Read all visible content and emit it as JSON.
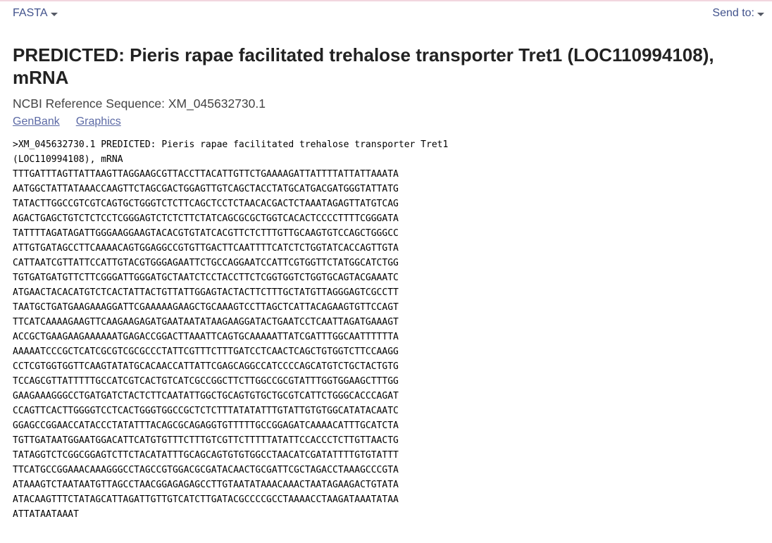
{
  "toolbar": {
    "format_label": "FASTA",
    "send_to_label": "Send to:"
  },
  "record": {
    "title": "PREDICTED: Pieris rapae facilitated trehalose transporter Tret1 (LOC110994108), mRNA",
    "reference": "NCBI Reference Sequence: XM_045632730.1",
    "views": [
      "GenBank",
      "Graphics"
    ]
  },
  "fasta": {
    "header_lines": [
      ">XM_045632730.1 PREDICTED: Pieris rapae facilitated trehalose transporter Tret1",
      "(LOC110994108), mRNA"
    ],
    "sequence_lines": [
      "TTTGATTTAGTTATTAAGTTAGGAAGCGTTACCTTACATTGTTCTGAAAAGATTATTTTATTATTAAATA",
      "AATGGCTATTATAAACCAAGTTCTAGCGACTGGAGTTGTCAGCTACCTATGCATGACGATGGGTATTATG",
      "TATACTTGGCCGTCGTCAGTGCTGGGTCTCTTCAGCTCCTCTAACACGACTCTAAATAGAGTTATGTCAG",
      "AGACTGAGCTGTCTCTCCTCGGGAGTCTCTCTTCTATCAGCGCGCTGGTCACACTCCCCTTTTCGGGATA",
      "TATTTTAGATAGATTGGGAAGGAAGTACACGTGTATCACGTTCTCTTTGTTGCAAGTGTCCAGCTGGGCC",
      "ATTGTGATAGCCTTCAAAACAGTGGAGGCCGTGTTGACTTCAATTTTCATCTCTGGTATCACCAGTTGTA",
      "CATTAATCGTTATTCCATTGTACGTGGGAGAATTCTGCCAGGAATCCATTCGTGGTTCTATGGCATCTGG",
      "TGTGATGATGTTCTTCGGGATTGGGATGCTAATCTCCTACCTTCTCGGTGGTCTGGTGCAGTACGAAATC",
      "ATGAACTACACATGTCTCACTATTACTGTTATTGGAGTACTACTTCTTTGCTATGTTAGGGAGTCGCCTT",
      "TAATGCTGATGAAGAAAGGATTCGAAAAAGAAGCTGCAAAGTCCTTAGCTCATTACAGAAGTGTTCCAGT",
      "TTCATCAAAAGAAGTTCAAGAAGAGATGAATAATATAAGAAGGATACTGAATCCTCAATTAGATGAAAGT",
      "ACCGCTGAAGAAGAAAAAATGAGACCGGACTTAAATTCAGTGCAAAAATTATCGATTTGGCAATTTTTTA",
      "AAAAATCCCGCTCATCGCGTCGCGCCCTATTCGTTTCTTTGATCCTCAACTCAGCTGTGGTCTTCCAAGG",
      "CCTCGTGGTGGTTCAAGTATATGCACAACCATTATTCGAGCAGGCCATCCCCAGCATGTCTGCTACTGTG",
      "TCCAGCGTTATTTTTGCCATCGTCACTGTCATCGCCGGCTTCTTGGCCGCGTATTTGGTGGAAGCTTTGG",
      "GAAGAAAGGGCCTGATGATCTACTCTTCAATATTGGCTGCAGTGTGCTGCGTCATTCTGGGCACCCAGAT",
      "CCAGTTCACTTGGGGTCCTCACTGGGTGGCCGCTCTCTTTATATATTTGTATTGTGTGGCATATACAATC",
      "GGAGCCGGAACCATACCCTATATTTACAGCGCAGAGGTGTTTTTGCCGGAGATCAAAACATTTGCATCTA",
      "TGTTGATAATGGAATGGACATTCATGTGTTTCTTTGTCGTTCTTTTTATATTCCACCCTCTTGTTAACTG",
      "TATAGGTCTCGGCGGAGTCTTCTACATATTTGCAGCAGTGTGTGGCCTAACATCGATATTTTGTGTATTT",
      "TTCATGCCGGAAACAAAGGGCCTAGCCGTGGACGCGATACAACTGCGATTCGCTAGACCTAAAGCCCGTA",
      "ATAAAGTCTAATAATGTTAGCCTAACGGAGAGAGCCTTGTAATATAAACAAACTAATAGAAGACTGTATA",
      "ATACAAGTTTCTATAGCATTAGATTGTTGTCATCTTGATACGCCCCGCCTAAAACCTAAGATAAATATAA",
      "ATTATAATAAAT"
    ]
  }
}
